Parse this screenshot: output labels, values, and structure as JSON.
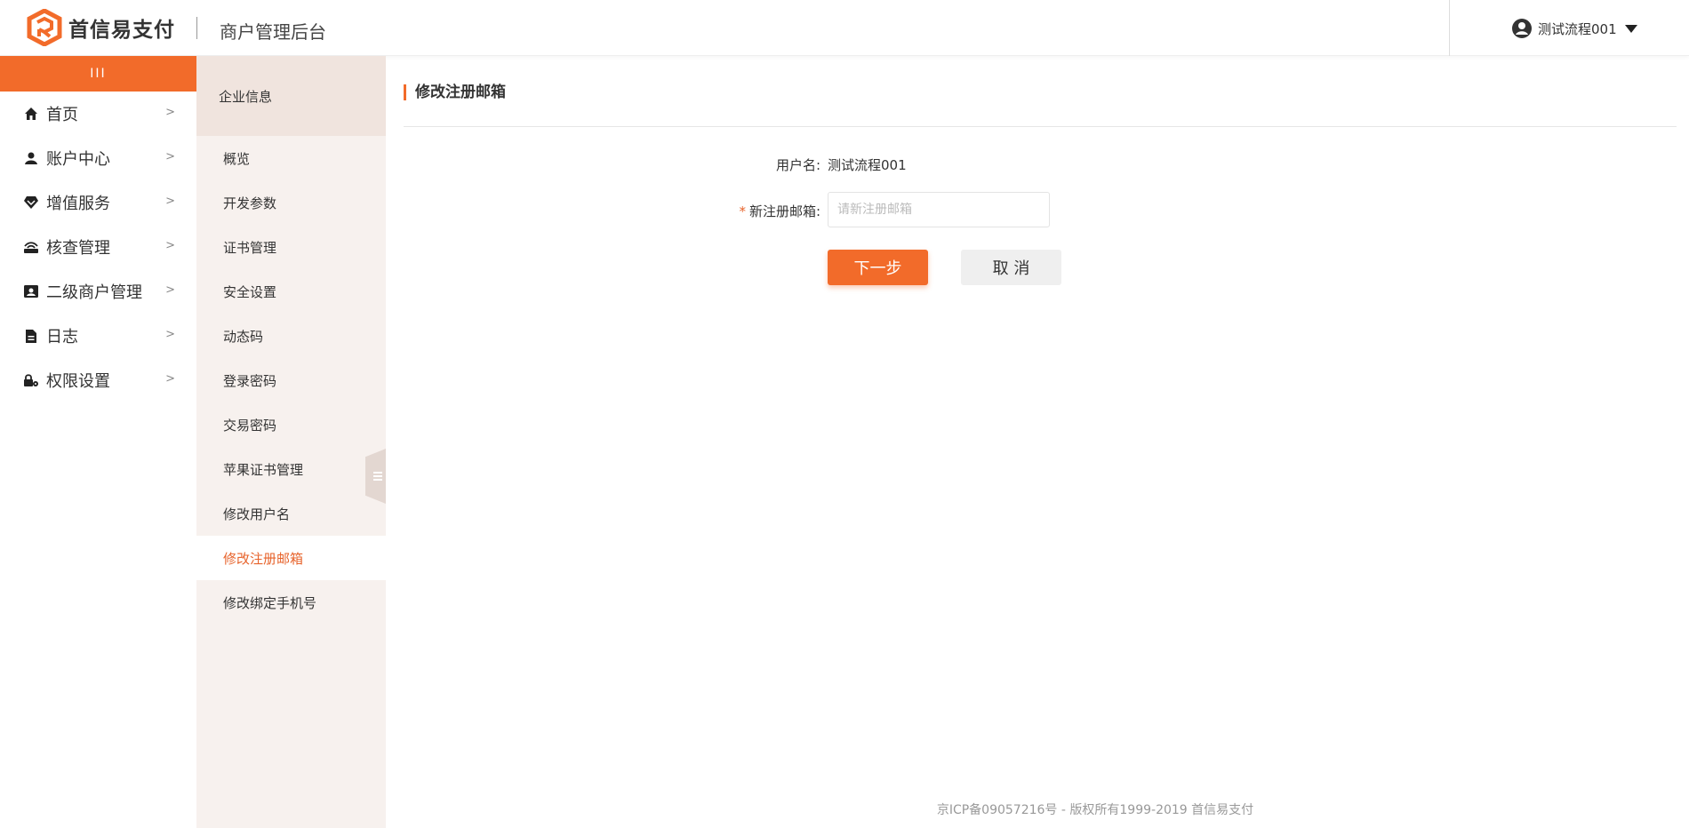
{
  "header": {
    "brand": "首信易支付",
    "subtitle": "商户管理后台",
    "user_name": "测试流程001"
  },
  "sidebar": {
    "toggle_glyph": "III",
    "items": [
      {
        "label": "首页",
        "icon": "home-icon"
      },
      {
        "label": "账户中心",
        "icon": "user-icon"
      },
      {
        "label": "增值服务",
        "icon": "heart-icon"
      },
      {
        "label": "核查管理",
        "icon": "router-icon"
      },
      {
        "label": "二级商户管理",
        "icon": "id-card-icon"
      },
      {
        "label": "日志",
        "icon": "document-icon"
      },
      {
        "label": "权限设置",
        "icon": "lock-gear-icon"
      }
    ]
  },
  "subnav": {
    "heading": "企业信息",
    "items": [
      {
        "label": "概览"
      },
      {
        "label": "开发参数"
      },
      {
        "label": "证书管理"
      },
      {
        "label": "安全设置"
      },
      {
        "label": "动态码"
      },
      {
        "label": "登录密码"
      },
      {
        "label": "交易密码"
      },
      {
        "label": "苹果证书管理"
      },
      {
        "label": "修改用户名"
      },
      {
        "label": "修改注册邮箱"
      },
      {
        "label": "修改绑定手机号"
      }
    ],
    "active_index": 9
  },
  "main": {
    "page_title": "修改注册邮箱",
    "username_label": "用户名:",
    "username_value": "测试流程001",
    "required_mark": "*",
    "email_label": "新注册邮箱:",
    "email_value": "",
    "email_placeholder": "请新注册邮箱",
    "next_button": "下一步",
    "cancel_button": "取 消"
  },
  "footer": {
    "text": "京ICP备09057216号 - 版权所有1999-2019 首信易支付"
  },
  "colors": {
    "accent": "#f26b2a",
    "subnav_bg": "#f7f1ee",
    "subnav_head_bg": "#f0e4de"
  }
}
